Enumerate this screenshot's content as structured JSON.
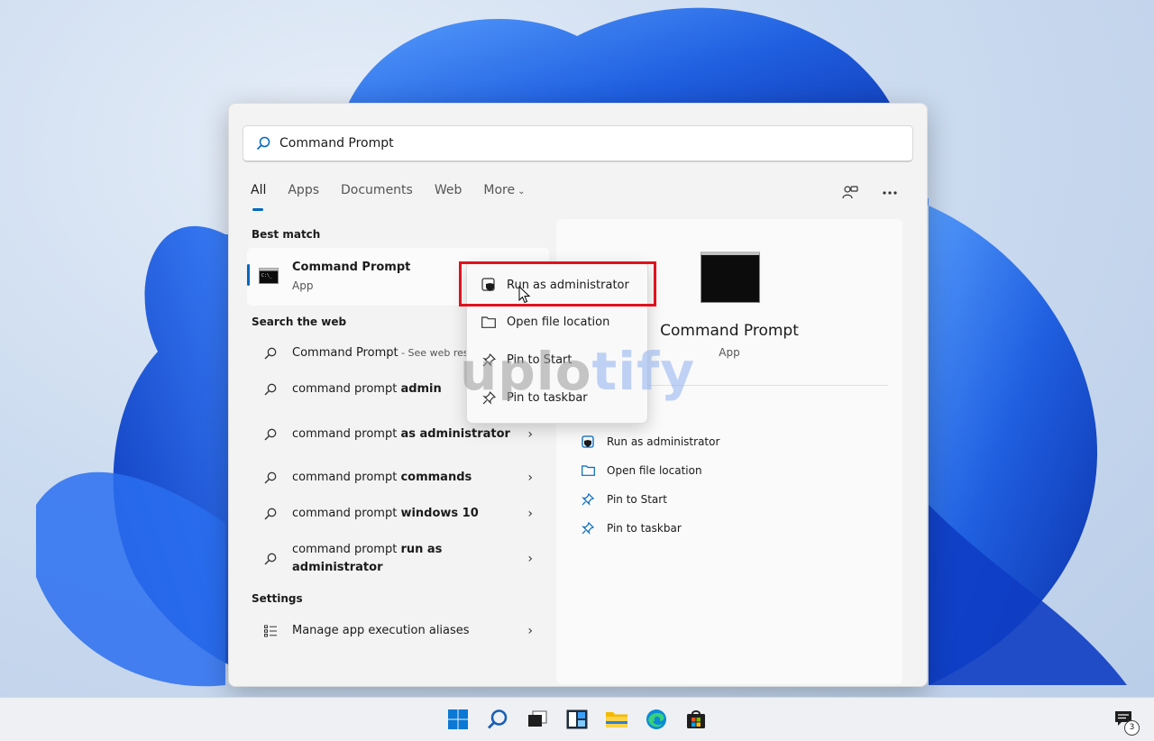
{
  "search": {
    "value": "Command Prompt",
    "icon": "search-icon"
  },
  "tabs": [
    {
      "label": "All",
      "active": true
    },
    {
      "label": "Apps"
    },
    {
      "label": "Documents"
    },
    {
      "label": "Web"
    },
    {
      "label": "More"
    }
  ],
  "top_icons": [
    "share-account-icon",
    "more-options-icon"
  ],
  "sections": {
    "best_match": "Best match",
    "search_web": "Search the web",
    "settings": "Settings"
  },
  "best_match": {
    "title": "Command Prompt",
    "subtitle": "App",
    "icon": "cmd-icon"
  },
  "web_results": [
    {
      "prefix": "Command Prompt",
      "bold": "",
      "hint": " - See web resu",
      "has_arrow": false
    },
    {
      "prefix": "command prompt ",
      "bold": "admin",
      "hint": "",
      "has_arrow": false
    },
    {
      "prefix": "command prompt ",
      "bold": "as administrator",
      "hint": "",
      "has_arrow": true
    },
    {
      "prefix": "command prompt ",
      "bold": "commands",
      "hint": "",
      "has_arrow": true
    },
    {
      "prefix": "command prompt ",
      "bold": "windows 10",
      "hint": "",
      "has_arrow": true
    },
    {
      "prefix": "command prompt ",
      "bold": "run as administrator",
      "hint": "",
      "has_arrow": true
    }
  ],
  "settings_items": [
    {
      "label": "Manage app execution aliases",
      "icon": "list-icon",
      "has_arrow": true
    }
  ],
  "details": {
    "title": "Command Prompt",
    "subtitle": "App",
    "actions": [
      {
        "label": "Run as administrator",
        "icon": "shield-icon"
      },
      {
        "label": "Open file location",
        "icon": "folder-icon"
      },
      {
        "label": "Pin to Start",
        "icon": "pin-icon"
      },
      {
        "label": "Pin to taskbar",
        "icon": "pin-icon"
      }
    ]
  },
  "context_menu": [
    {
      "label": "Run as administrator",
      "icon": "shield-icon"
    },
    {
      "label": "Open file location",
      "icon": "folder-icon"
    },
    {
      "label": "Pin to Start",
      "icon": "pin-icon"
    },
    {
      "label": "Pin to taskbar",
      "icon": "pin-icon"
    }
  ],
  "watermark": {
    "part1": "uplo",
    "part2": "tify"
  },
  "taskbar": {
    "icons": [
      "start-icon",
      "search-icon",
      "task-view-icon",
      "widgets-icon",
      "file-explorer-icon",
      "edge-icon",
      "store-icon"
    ],
    "notification_count": "3"
  },
  "colors": {
    "accent": "#0067c0",
    "highlight": "#e0121e",
    "wallpaper_blue": "#1f5fe0"
  }
}
